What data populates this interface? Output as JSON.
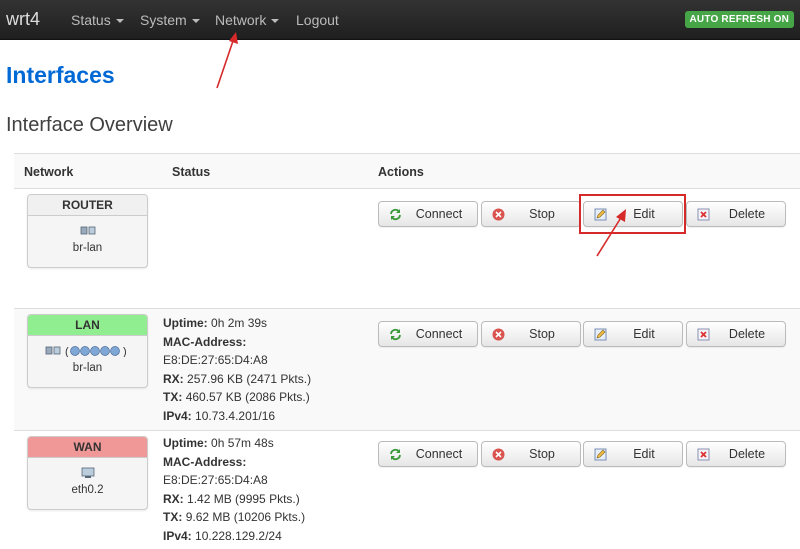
{
  "navbar": {
    "brand": "wrt4",
    "menu": [
      {
        "label": "Status",
        "has_caret": true
      },
      {
        "label": "System",
        "has_caret": true
      },
      {
        "label": "Network",
        "has_caret": true
      },
      {
        "label": "Logout",
        "has_caret": false
      }
    ],
    "refresh_badge": "AUTO REFRESH ON"
  },
  "page": {
    "title": "Interfaces",
    "section": "Interface Overview"
  },
  "table": {
    "headers": {
      "network": "Network",
      "status": "Status",
      "actions": "Actions"
    },
    "action_labels": {
      "connect": "Connect",
      "stop": "Stop",
      "edit": "Edit",
      "delete": "Delete"
    },
    "rows": [
      {
        "name": "ROUTER",
        "header_color": "#f0f0f0",
        "device": "br-lan",
        "status": []
      },
      {
        "name": "LAN",
        "header_color": "#90ee90",
        "device": "br-lan",
        "status": [
          {
            "label": "Uptime:",
            "value": "0h 2m 39s"
          },
          {
            "label": "MAC-Address:",
            "value": ""
          },
          {
            "label": "",
            "value": "E8:DE:27:65:D4:A8"
          },
          {
            "label": "RX:",
            "value": "257.96 KB (2471 Pkts.)"
          },
          {
            "label": "TX:",
            "value": "460.57 KB (2086 Pkts.)"
          },
          {
            "label": "IPv4:",
            "value": "10.73.4.201/16"
          }
        ]
      },
      {
        "name": "WAN",
        "header_color": "#f09898",
        "device": "eth0.2",
        "status": [
          {
            "label": "Uptime:",
            "value": "0h 57m 48s"
          },
          {
            "label": "MAC-Address:",
            "value": ""
          },
          {
            "label": "",
            "value": "E8:DE:27:65:D4:A8"
          },
          {
            "label": "RX:",
            "value": "1.42 MB (9995 Pkts.)"
          },
          {
            "label": "TX:",
            "value": "9.62 MB (10206 Pkts.)"
          },
          {
            "label": "IPv4:",
            "value": "10.228.129.2/24"
          }
        ]
      }
    ]
  },
  "colors": {
    "brand_blue": "#0069d6",
    "badge_green": "#46a546",
    "annotation_red": "#d62a2a"
  },
  "icons": {
    "connect": "refresh-icon",
    "stop": "stop-icon",
    "edit": "edit-icon",
    "delete": "delete-icon",
    "interface": "ethernet-port-icon"
  }
}
